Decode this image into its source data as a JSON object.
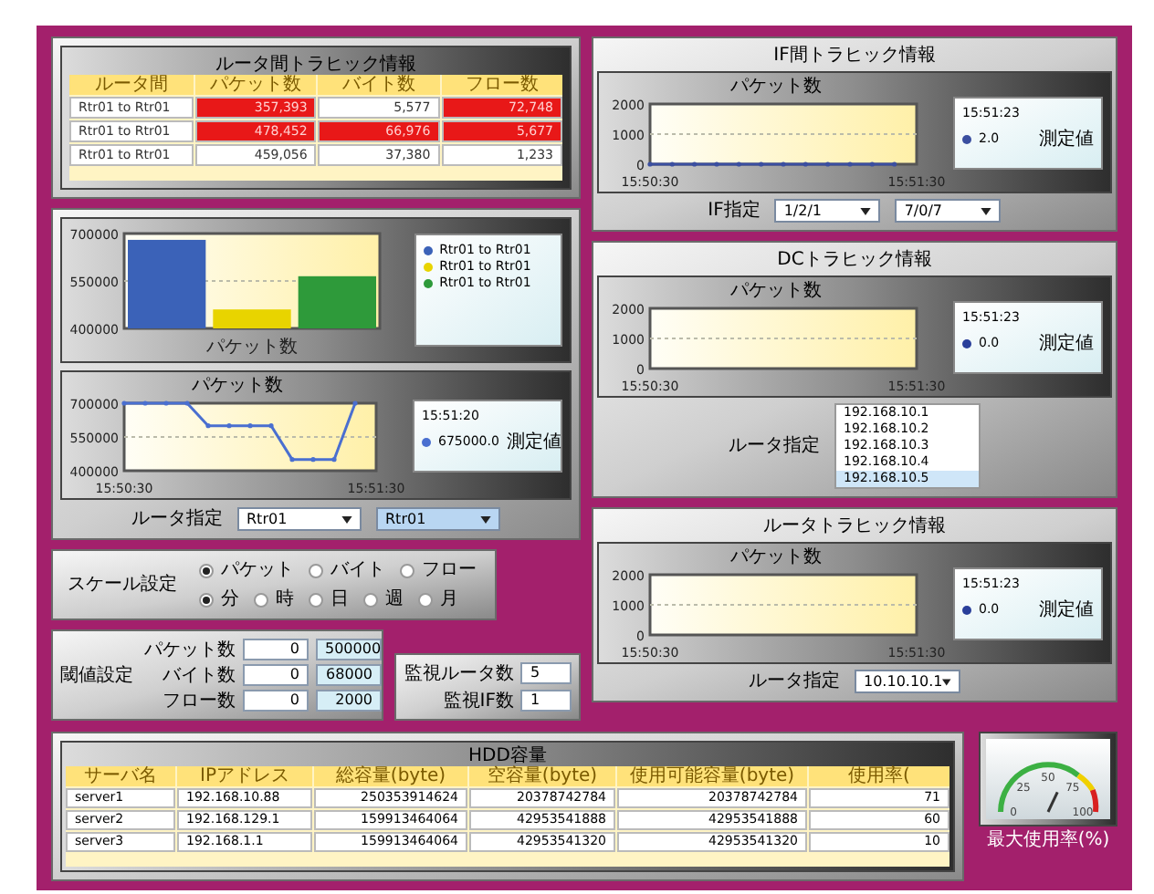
{
  "route_traffic": {
    "title": "ルータ間トラヒック情報",
    "columns": [
      "ルータ間",
      "パケット数",
      "バイト数",
      "フロー数"
    ],
    "rows": [
      {
        "cells": [
          {
            "text": "Rtr01 to Rtr01",
            "alert": false
          },
          {
            "text": "357,393",
            "alert": true
          },
          {
            "text": "5,577",
            "alert": false
          },
          {
            "text": "72,748",
            "alert": true
          }
        ]
      },
      {
        "cells": [
          {
            "text": "Rtr01 to Rtr01",
            "alert": false
          },
          {
            "text": "478,452",
            "alert": true
          },
          {
            "text": "66,976",
            "alert": true
          },
          {
            "text": "5,677",
            "alert": true
          }
        ]
      },
      {
        "cells": [
          {
            "text": "Rtr01 to Rtr01",
            "alert": false
          },
          {
            "text": "459,056",
            "alert": false
          },
          {
            "text": "37,380",
            "alert": false
          },
          {
            "text": "1,233",
            "alert": false
          }
        ]
      }
    ]
  },
  "bar_panel": {
    "chart_data": {
      "type": "bar",
      "xlabel": "パケット数",
      "categories": [
        null
      ],
      "ylim": [
        400000,
        700000
      ],
      "yticks": [
        400000,
        550000,
        700000
      ],
      "series": [
        {
          "name": "Rtr01 to Rtr01",
          "color": "#3b62b8",
          "values": [
            680000
          ]
        },
        {
          "name": "Rtr01 to Rtr01",
          "color": "#e8d400",
          "values": [
            460000
          ]
        },
        {
          "name": "Rtr01 to Rtr01",
          "color": "#2e9a3a",
          "values": [
            565000
          ]
        }
      ]
    }
  },
  "line_panel": {
    "chart_data": {
      "type": "line",
      "title": "パケット数",
      "ylim": [
        400000,
        700000
      ],
      "yticks": [
        400000,
        550000,
        700000
      ],
      "categories": [
        "15:50:30",
        null,
        null,
        null,
        null,
        null,
        null,
        null,
        null,
        null,
        null,
        null,
        "15:51:30"
      ],
      "series": [
        {
          "name": "測定値",
          "color": "#4a6fd0",
          "values": [
            700000,
            700000,
            700000,
            700000,
            600000,
            600000,
            600000,
            600000,
            450000,
            450000,
            450000,
            700000,
            null
          ]
        }
      ]
    },
    "legend": {
      "time": "15:51:20",
      "value": "675000.0"
    },
    "selector_label": "ルータ指定",
    "selects": [
      {
        "value": "Rtr01",
        "focused": false
      },
      {
        "value": "Rtr01",
        "focused": true
      }
    ]
  },
  "scale": {
    "label": "スケール設定",
    "groups": [
      [
        {
          "label": "パケット",
          "selected": true
        },
        {
          "label": "バイト",
          "selected": false
        },
        {
          "label": "フロー",
          "selected": false
        }
      ],
      [
        {
          "label": "分",
          "selected": true
        },
        {
          "label": "時",
          "selected": false
        },
        {
          "label": "日",
          "selected": false
        },
        {
          "label": "週",
          "selected": false
        },
        {
          "label": "月",
          "selected": false
        }
      ]
    ]
  },
  "threshold": {
    "label": "閾値設定",
    "rows": [
      {
        "label": "パケット数",
        "spin": "0",
        "value": "500000"
      },
      {
        "label": "バイト数",
        "spin": "0",
        "value": "68000"
      },
      {
        "label": "フロー数",
        "spin": "0",
        "value": "2000"
      }
    ]
  },
  "counts": [
    {
      "label": "監視ルータ数",
      "value": "5"
    },
    {
      "label": "監視IF数",
      "value": "1"
    }
  ],
  "hdd": {
    "title": "HDD容量",
    "columns": [
      "サーバ名",
      "IPアドレス",
      "総容量(byte)",
      "空容量(byte)",
      "使用可能容量(byte)",
      "使用率("
    ],
    "rows": [
      [
        "server1",
        "192.168.10.88",
        "250353914624",
        "20378742784",
        "20378742784",
        "71"
      ],
      [
        "server2",
        "192.168.129.1",
        "159913464064",
        "42953541888",
        "42953541888",
        "60"
      ],
      [
        "server3",
        "192.168.1.1",
        "159913464064",
        "42953541320",
        "42953541320",
        "10"
      ]
    ]
  },
  "gauge": {
    "label": "最大使用率(%)",
    "ticks": [
      "0",
      "25",
      "50",
      "75",
      "100"
    ]
  },
  "if_traffic": {
    "title": "IF間トラヒック情報",
    "chart_data": {
      "type": "line",
      "title": "パケット数",
      "ylim": [
        0,
        2000
      ],
      "yticks": [
        0,
        1000,
        2000
      ],
      "categories": [
        "15:50:30",
        null,
        null,
        null,
        null,
        null,
        null,
        null,
        null,
        null,
        null,
        null,
        "15:51:30"
      ],
      "series": [
        {
          "name": "測定値",
          "color": "#3b4fa0",
          "values": [
            0,
            0,
            0,
            0,
            0,
            0,
            0,
            0,
            0,
            0,
            0,
            0,
            null
          ]
        }
      ]
    },
    "legend": {
      "time": "15:51:23",
      "value": "2.0"
    },
    "selector_label": "IF指定",
    "selects": [
      {
        "value": "1/2/1",
        "focused": false
      },
      {
        "value": "7/0/7",
        "focused": false
      }
    ]
  },
  "dc_traffic": {
    "title": "DCトラヒック情報",
    "chart_data": {
      "type": "line",
      "title": "パケット数",
      "ylim": [
        0,
        2000
      ],
      "yticks": [
        0,
        1000,
        2000
      ],
      "categories": [
        "15:50:30",
        null,
        null,
        null,
        null,
        null,
        null,
        null,
        null,
        null,
        null,
        null,
        "15:51:30"
      ]
    },
    "legend": {
      "time": "15:51:23",
      "value": "0.0",
      "label": "測定値"
    },
    "selector_label": "ルータ指定",
    "options": [
      {
        "label": "192.168.10.1",
        "selected": false
      },
      {
        "label": "192.168.10.2",
        "selected": false
      },
      {
        "label": "192.168.10.3",
        "selected": false
      },
      {
        "label": "192.168.10.4",
        "selected": false
      },
      {
        "label": "192.168.10.5",
        "selected": true
      }
    ]
  },
  "router_traffic": {
    "title": "ルータトラヒック情報",
    "chart_data": {
      "type": "line",
      "title": "パケット数",
      "ylim": [
        0,
        2000
      ],
      "yticks": [
        0,
        1000,
        2000
      ],
      "categories": [
        "15:50:30",
        null,
        null,
        null,
        null,
        null,
        null,
        null,
        null,
        null,
        null,
        null,
        "15:51:30"
      ]
    },
    "legend": {
      "time": "15:51:23",
      "value": "0.0",
      "label": "測定値"
    },
    "selector_label": "ルータ指定",
    "selects": [
      {
        "value": "10.10.10.1",
        "focused": false
      }
    ]
  }
}
